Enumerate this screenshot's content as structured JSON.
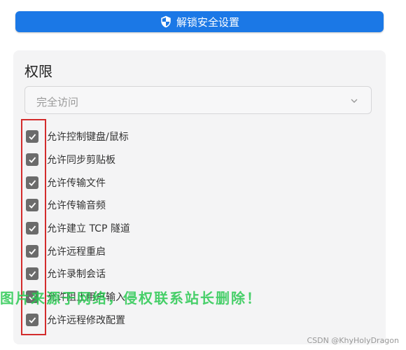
{
  "unlock_button": {
    "label": "解锁安全设置",
    "icon": "shield-icon",
    "color": "#1b78e6"
  },
  "permissions": {
    "title": "权限",
    "access_select": {
      "value": "完全访问",
      "icon": "chevron-down-icon"
    },
    "items": [
      {
        "label": "允许控制键盘/鼠标",
        "checked": true
      },
      {
        "label": "允许同步剪贴板",
        "checked": true
      },
      {
        "label": "允许传输文件",
        "checked": true
      },
      {
        "label": "允许传输音频",
        "checked": true
      },
      {
        "label": "允许建立 TCP 隧道",
        "checked": true
      },
      {
        "label": "允许远程重启",
        "checked": true
      },
      {
        "label": "允许录制会话",
        "checked": true
      },
      {
        "label": "允许阻止用户输入",
        "checked": true
      },
      {
        "label": "允许远程修改配置",
        "checked": true
      }
    ]
  },
  "annotation": {
    "highlight_color": "#d32c2c"
  },
  "watermarks": {
    "overlay_text": "图片来源于网络，侵权联系站长删除！",
    "source_text": "CSDN @KhyHolyDragon"
  }
}
